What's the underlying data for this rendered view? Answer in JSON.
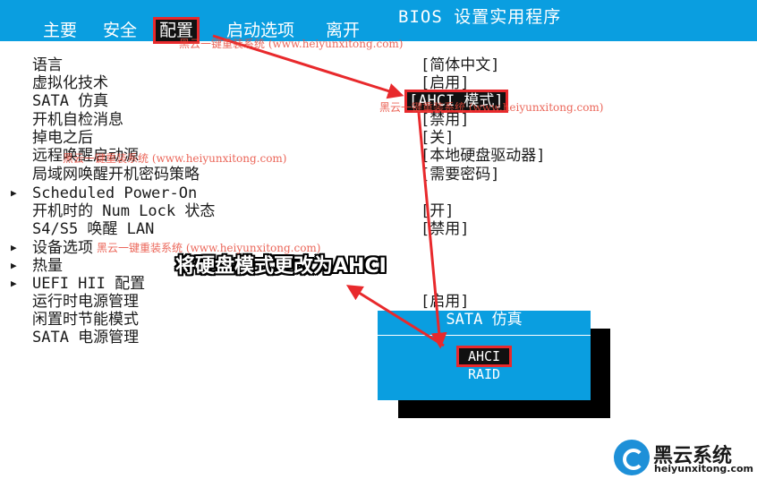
{
  "header": {
    "bios_title": "BIOS 设置实用程序",
    "tabs": [
      {
        "label": "主要"
      },
      {
        "label": "安全"
      },
      {
        "label": "配置"
      },
      {
        "label": "启动选项"
      },
      {
        "label": "离开"
      }
    ],
    "active_tab": "配置"
  },
  "settings": [
    {
      "label": "语言",
      "value": "[简体中文]"
    },
    {
      "label": "虚拟化技术",
      "value": "[启用]"
    },
    {
      "label": "SATA 仿真",
      "value": "[AHCI 模式]"
    },
    {
      "label": "开机自检消息",
      "value": "[禁用]"
    },
    {
      "label": "掉电之后",
      "value": "[关]"
    },
    {
      "label": "远程唤醒启动源",
      "value": "[本地硬盘驱动器]"
    },
    {
      "label": "局域网唤醒开机密码策略",
      "value": "[需要密码]"
    },
    {
      "label": "Scheduled Power-On",
      "value": "",
      "submenu": true
    },
    {
      "label": "开机时的 Num Lock 状态",
      "value": "[开]"
    },
    {
      "label": "S4/S5 唤醒 LAN",
      "value": "[禁用]"
    },
    {
      "label": "设备选项",
      "value": "",
      "submenu": true
    },
    {
      "label": "热量",
      "value": "",
      "submenu": true
    },
    {
      "label": "UEFI HII 配置",
      "value": "",
      "submenu": true
    },
    {
      "label": "运行时电源管理",
      "value": "[启用]"
    },
    {
      "label": "闲置时节能模式",
      "value": ""
    },
    {
      "label": "SATA 电源管理",
      "value": ""
    }
  ],
  "popup": {
    "title": "SATA 仿真",
    "options": [
      "AHCI",
      "RAID"
    ],
    "selected": "AHCI"
  },
  "annotation": {
    "text": "将硬盘模式更改为AHCI",
    "color": "#ffffff",
    "outline_color": "#000000"
  },
  "watermarks": [
    "黑云一键重装系统 (www.heiyunxitong.com)",
    "黑云一键重装系统 (www.heiyunxitong.com)",
    "黑云一键重装系统 (www.heiyunxitong.com)",
    "黑云一键重装系统 (www.heiyunxitong.com)"
  ],
  "brand": {
    "name": "黑云系统",
    "url": "heiyunxitong.com"
  },
  "colors": {
    "header_bg": "#0a9ee0",
    "highlight_border": "#e8292c",
    "arrow": "#e8292c",
    "popup_bg": "#0a9ee0"
  },
  "icons": {
    "submenu_arrow": "triangle-right-icon",
    "logo": "heiyun-logo-icon"
  }
}
